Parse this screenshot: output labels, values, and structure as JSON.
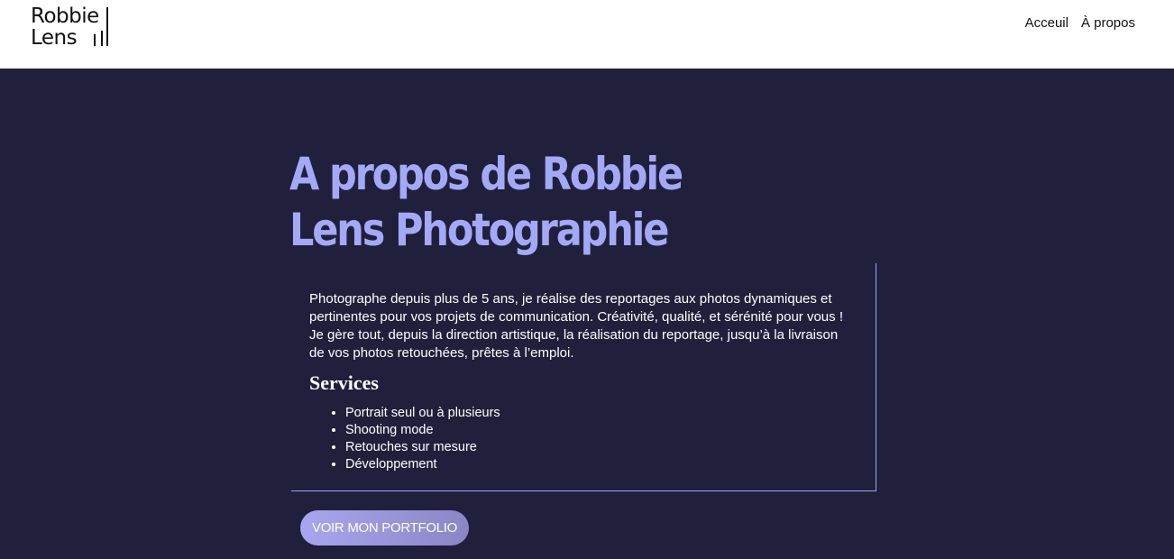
{
  "header": {
    "logo": {
      "line1": "Robbie",
      "line2": "Lens"
    },
    "nav": [
      {
        "label": "Acceuil"
      },
      {
        "label": "À propos"
      }
    ]
  },
  "main": {
    "title": "A propos de Robbie Lens Photographie",
    "intro": "Photographe depuis plus de 5 ans, je réalise des reportages aux photos dynamiques et pertinentes pour vos projets de communication. Créativité, qualité, et sérénité pour vous ! Je gère tout, depuis la direction artistique, la réalisation du reportage, jusqu’à la livraison de vos photos retouchées, prêtes à l’emploi.",
    "services": {
      "title": "Services",
      "items": [
        "Portrait seul ou à plusieurs",
        "Shooting mode",
        "Retouches sur mesure",
        "Développement"
      ]
    },
    "cta_label": "VOIR MON PORTFOLIO"
  },
  "colors": {
    "background_dark": "#20203c",
    "accent": "#a3a9f6",
    "header_bg": "#ffffff"
  }
}
